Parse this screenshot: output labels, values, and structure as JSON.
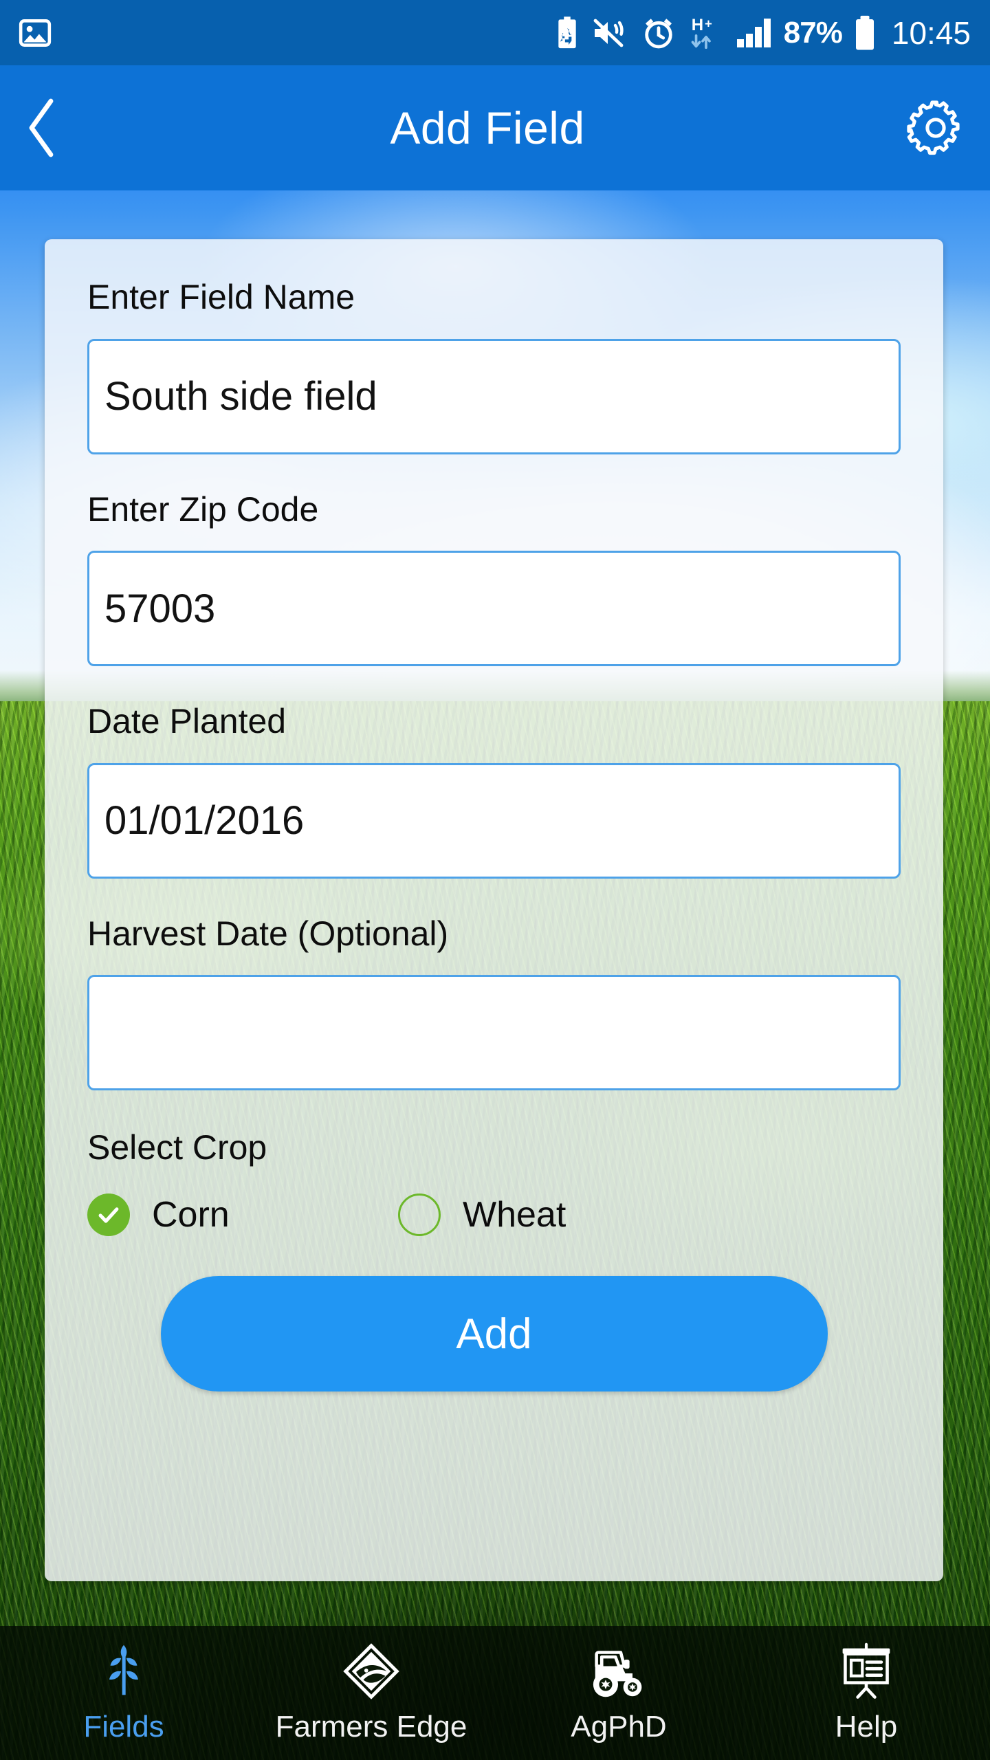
{
  "statusbar": {
    "time": "10:45",
    "battery_percent": "87%",
    "icons": [
      "screenshot-image-icon",
      "battery-saver-icon",
      "sound-mute-vibrate-icon",
      "alarm-clock-icon",
      "hplus-data-icon",
      "signal-bars-icon",
      "battery-icon"
    ],
    "data_network": "H+"
  },
  "appbar": {
    "title": "Add Field",
    "back_icon": "chevron-left-icon",
    "settings_icon": "gear-icon"
  },
  "form": {
    "field_name": {
      "label": "Enter Field Name",
      "value": "South side field",
      "placeholder": ""
    },
    "zip_code": {
      "label": "Enter Zip Code",
      "value": "57003",
      "placeholder": ""
    },
    "date_planted": {
      "label": "Date Planted",
      "value": "01/01/2016",
      "placeholder": ""
    },
    "harvest_date": {
      "label": "Harvest Date (Optional)",
      "value": "",
      "placeholder": ""
    },
    "crop": {
      "label": "Select Crop",
      "options": [
        {
          "label": "Corn",
          "selected": true
        },
        {
          "label": "Wheat",
          "selected": false
        }
      ]
    },
    "submit_label": "Add"
  },
  "bottomnav": {
    "items": [
      {
        "label": "Fields",
        "icon": "wheat-plant-icon",
        "active": true
      },
      {
        "label": "Farmers Edge",
        "icon": "farmers-edge-logo-icon",
        "active": false
      },
      {
        "label": "AgPhD",
        "icon": "tractor-icon",
        "active": false
      },
      {
        "label": "Help",
        "icon": "presentation-board-icon",
        "active": false
      }
    ]
  },
  "colors": {
    "statusbar": "#0760ae",
    "appbar": "#0d72d6",
    "input_border": "#4ea2e8",
    "accent_button": "#2196f3",
    "crop_green": "#6cb82a",
    "nav_active": "#4a9ff0"
  }
}
